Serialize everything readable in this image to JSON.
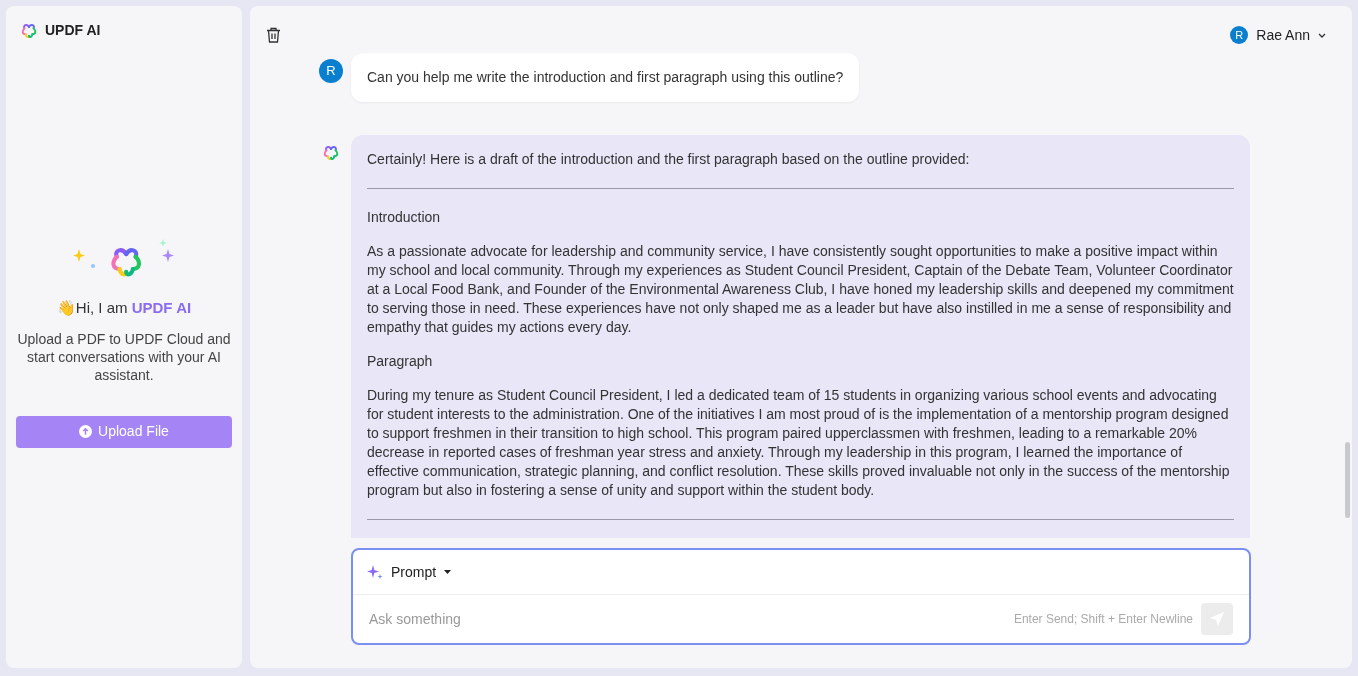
{
  "sidebar": {
    "brand": "UPDF AI",
    "greeting": {
      "wave": "👋",
      "text": "Hi, I am ",
      "highlight": "UPDF AI"
    },
    "description": "Upload a PDF to UPDF Cloud and start conversations with your AI assistant.",
    "upload_button": "Upload File"
  },
  "header": {
    "user": {
      "initial": "R",
      "name": "Rae Ann"
    }
  },
  "messages": [
    {
      "kind": "user",
      "avatar": "R",
      "text": "Can you help me write the introduction and first paragraph using this outline?"
    },
    {
      "kind": "assistant",
      "blocks": [
        {
          "kind": "text",
          "text": "Certainly! Here is a draft of the introduction and the first paragraph based on the outline provided:"
        },
        {
          "kind": "rule"
        },
        {
          "kind": "text",
          "text": "Introduction"
        },
        {
          "kind": "text",
          "text": "As a passionate advocate for leadership and community service, I have consistently sought opportunities to make a positive impact within my school and local community. Through my experiences as Student Council President, Captain of the Debate Team, Volunteer Coordinator at a Local Food Bank, and Founder of the Environmental Awareness Club, I have honed my leadership skills and deepened my commitment to serving those in need. These experiences have not only shaped me as a leader but have also instilled in me a sense of responsibility and empathy that guides my actions every day."
        },
        {
          "kind": "text",
          "text": "Paragraph"
        },
        {
          "kind": "text",
          "text": "During my tenure as Student Council President, I led a dedicated team of 15 students in organizing various school events and advocating for student interests to the administration. One of the initiatives I am most proud of is the implementation of a mentorship program designed to support freshmen in their transition to high school. This program paired upperclassmen with freshmen, leading to a remarkable 20% decrease in reported cases of freshman year stress and anxiety. Through my leadership in this program, I learned the importance of effective communication, strategic planning, and conflict resolution. These skills proved invaluable not only in the success of the mentorship program but also in fostering a sense of unity and support within the student body."
        },
        {
          "kind": "rule"
        }
      ]
    }
  ],
  "composer": {
    "mode": "Prompt",
    "placeholder": "Ask something",
    "hint": "Enter Send; Shift + Enter Newline"
  }
}
